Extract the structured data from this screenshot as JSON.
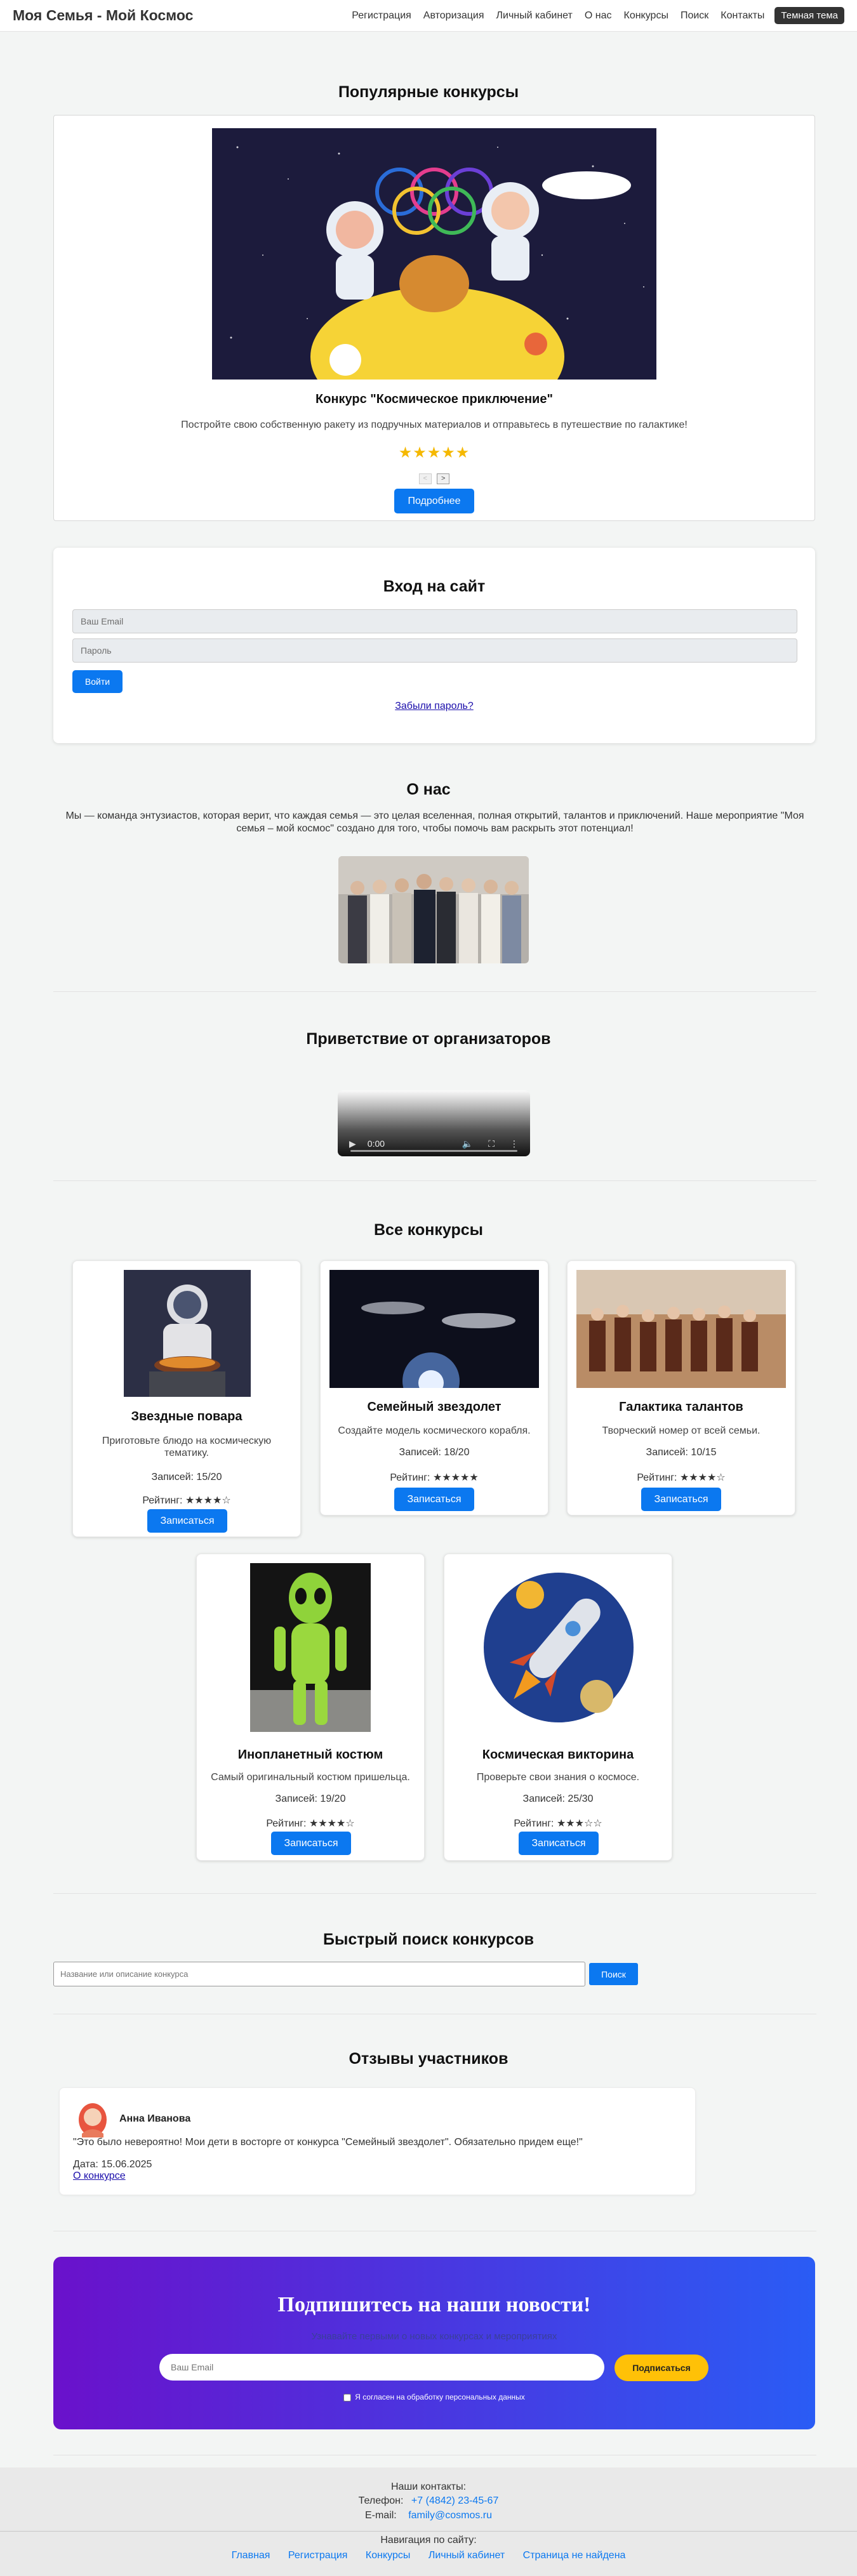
{
  "header": {
    "logo": "Моя Семья - Мой Космос",
    "nav": [
      "Регистрация",
      "Авторизация",
      "Личный кабинет",
      "О нас",
      "Конкурсы",
      "Поиск",
      "Контакты"
    ],
    "theme_button": "Темная тема"
  },
  "popular": {
    "heading": "Популярные конкурсы",
    "title": "Конкурс \"Космическое приключение\"",
    "description": "Постройте свою собственную ракету из подручных материалов и отправьтесь в путешествие по галактике!",
    "stars": "★★★★★",
    "prev": "<",
    "next": ">",
    "more_button": "Подробнее"
  },
  "login": {
    "title": "Вход на сайт",
    "email_placeholder": "Ваш Email",
    "password_placeholder": "Пароль",
    "submit": "Войти",
    "forgot": "Забыли пароль?"
  },
  "about": {
    "heading": "О нас",
    "text": "Мы — команда энтузиастов, которая верит, что каждая семья — это целая вселенная, полная открытий, талантов и приключений. Наше мероприятие \"Моя семья – мой космос\" создано для того, чтобы помочь вам раскрыть этот потенциал!"
  },
  "greeting": {
    "heading": "Приветствие от организаторов",
    "video_time": "0:00"
  },
  "contests": {
    "heading": "Все конкурсы",
    "items": [
      {
        "title": "Звездные повара",
        "description": "Приготовьте блюдо на космическую тематику.",
        "records": "Записей: 15/20",
        "rating": "Рейтинг: ★★★★☆",
        "button": "Записаться"
      },
      {
        "title": "Семейный звездолет",
        "description": "Создайте модель космического корабля.",
        "records": "Записей: 18/20",
        "rating": "Рейтинг: ★★★★★",
        "button": "Записаться"
      },
      {
        "title": "Галактика талантов",
        "description": "Творческий номер от всей семьи.",
        "records": "Записей: 10/15",
        "rating": "Рейтинг: ★★★★☆",
        "button": "Записаться"
      },
      {
        "title": "Инопланетный костюм",
        "description": "Самый оригинальный костюм пришельца.",
        "records": "Записей: 19/20",
        "rating": "Рейтинг: ★★★★☆",
        "button": "Записаться"
      },
      {
        "title": "Космическая викторина",
        "description": "Проверьте свои знания о космосе.",
        "records": "Записей: 25/30",
        "rating": "Рейтинг: ★★★☆☆",
        "button": "Записаться"
      }
    ]
  },
  "search": {
    "heading": "Быстрый поиск конкурсов",
    "placeholder": "Название или описание конкурса",
    "button": "Поиск"
  },
  "reviews": {
    "heading": "Отзывы участников",
    "items": [
      {
        "name": "Анна Иванова",
        "text": "\"Это было невероятно! Мои дети в восторге от конкурса \"Семейный звездолет\". Обязательно придем еще!\"",
        "date": "Дата: 15.06.2025",
        "link": "О конкурсе"
      }
    ]
  },
  "newsletter": {
    "title": "Подпишитесь на наши новости!",
    "subtitle": "Узнавайте первыми о новых конкурсах и мероприятиях",
    "placeholder": "Ваш Email",
    "button": "Подписаться",
    "consent": "Я согласен на обработку персональных данных"
  },
  "footer": {
    "contacts_title": "Наши контакты:",
    "phone_label": "Телефон:",
    "phone": "+7 (4842) 23-45-67",
    "email_label": "E-mail:",
    "email": "family@cosmos.ru",
    "nav_title": "Навигация по сайту:",
    "nav": [
      "Главная",
      "Регистрация",
      "Конкурсы",
      "Личный кабинет",
      "Страница не найдена"
    ]
  },
  "colors": {
    "accent": "#0b78f0",
    "stars": "#f5b800",
    "news_gradient_start": "#6a11cb",
    "news_gradient_end": "#2a5cf5",
    "news_button": "#ffc107"
  }
}
